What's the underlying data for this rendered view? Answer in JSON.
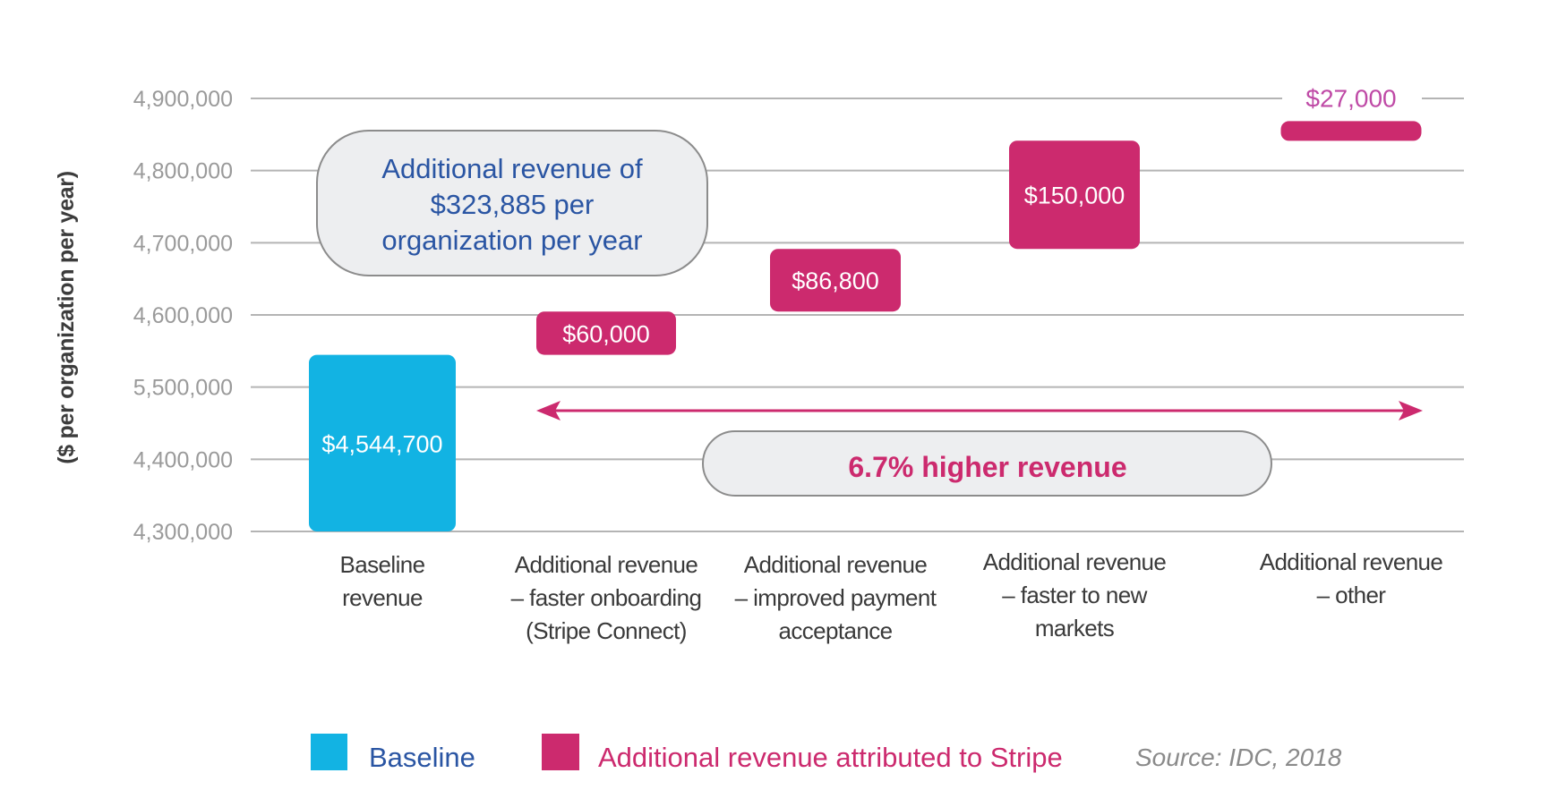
{
  "chart_data": {
    "type": "bar",
    "subtype": "waterfall",
    "title": "",
    "xlabel": "",
    "ylabel": "($ per organization per year)",
    "ylim": [
      4300000,
      4900000
    ],
    "y_ticks": [
      4300000,
      4400000,
      4500000,
      4600000,
      4700000,
      4800000,
      4900000
    ],
    "y_tick_labels": [
      "4,300,000",
      "4,400,000",
      "5,500,000",
      "4,600,000",
      "4,700,000",
      "4,800,000",
      "4,900,000"
    ],
    "grid": true,
    "categories": [
      [
        "Baseline",
        "revenue"
      ],
      [
        "Additional revenue",
        "– faster onboarding",
        "(Stripe Connect)"
      ],
      [
        "Additional revenue",
        "– improved payment",
        "acceptance"
      ],
      [
        "Additional revenue",
        "– faster to new",
        "markets"
      ],
      [
        "Additional revenue",
        "– other"
      ]
    ],
    "bars": [
      {
        "series": "Baseline",
        "start": 4300000,
        "value": 4544700,
        "label": "$4,544,700",
        "label_position": "inside"
      },
      {
        "series": "Additional revenue attributed to Stripe",
        "start": 4544700,
        "value": 60000,
        "label": "$60,000",
        "label_position": "inside"
      },
      {
        "series": "Additional revenue attributed to Stripe",
        "start": 4604700,
        "value": 86800,
        "label": "$86,800",
        "label_position": "inside"
      },
      {
        "series": "Additional revenue attributed to Stripe",
        "start": 4691500,
        "value": 150000,
        "label": "$150,000",
        "label_position": "inside"
      },
      {
        "series": "Additional revenue attributed to Stripe",
        "start": 4841500,
        "value": 27000,
        "label": "$27,000",
        "label_position": "above"
      }
    ],
    "series": [
      {
        "name": "Baseline",
        "color": "#12b3e3"
      },
      {
        "name": "Additional revenue attributed to Stripe",
        "color": "#cc2a6e"
      }
    ],
    "annotations": [
      {
        "id": "total",
        "lines": [
          "Additional revenue of",
          "$323,885 per",
          "organization per year"
        ],
        "color": "#2a55a3"
      },
      {
        "id": "pct",
        "text": "6.7% higher revenue",
        "color": "#cc2a6e",
        "arrow": "double-headed"
      }
    ],
    "legend": {
      "placement": "bottom",
      "items": [
        {
          "label": "Baseline",
          "swatch": "#12b3e3",
          "text_color": "#2a55a3"
        },
        {
          "label": "Additional revenue attributed to Stripe",
          "swatch": "#cc2a6e",
          "text_color": "#cc2a6e"
        }
      ]
    },
    "source": "Source: IDC, 2018"
  }
}
